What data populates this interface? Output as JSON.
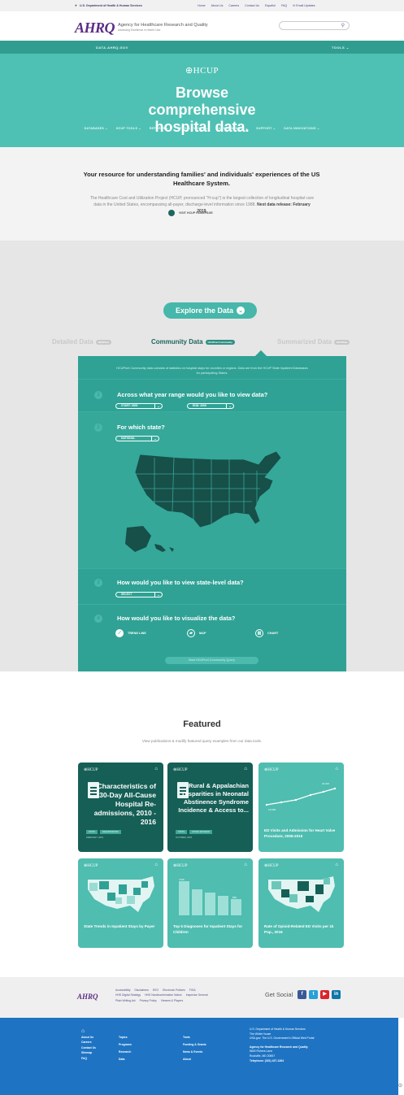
{
  "gov": {
    "dept": "U.S. Department of Health & Human Services",
    "links": [
      "Home",
      "About Us",
      "Careers",
      "Contact Us",
      "Español",
      "FAQ",
      "Email Updates"
    ]
  },
  "brand": {
    "logo": "AHRQ",
    "agency": "Agency for Healthcare Research and Quality",
    "tagline": "Advancing Excellence in Health Care",
    "search_placeholder": ""
  },
  "datanav": {
    "site": "DATA.AHRQ.GOV",
    "tools": "TOOLS ⌄"
  },
  "hero": {
    "hcup": "⊕HCUP",
    "title": "Browse comprehensive hospital data.",
    "menu": [
      "DATABASES ⌄",
      "HCUP TOOLS ⌄",
      "REPORTS ⌄",
      "NEWS & EVENTS ⌄",
      "PURCHASE DATA ⌄",
      "SUPPORT ⌄",
      "DATA INNOVATIONS ⌄"
    ]
  },
  "intro": {
    "heading": "Your resource for understanding families' and individuals' experiences of the US Healthcare System.",
    "body": "The Healthcare Cost and Utilization Project (HCUP, pronounced \"H-cup\") is the largest collection of longitudinal hospital care data in the United States, encompassing all-payer, discharge-level information since 1988.",
    "release": "Next data release: February 2019.",
    "visit": "VISIT HCUP HOMEPAGE"
  },
  "explore": {
    "button": "Explore the Data",
    "tabs": [
      {
        "label": "Detailed Data",
        "badge": "HCUPnet"
      },
      {
        "label": "Community Data",
        "badge": "HCUPnet Community"
      },
      {
        "label": "Summarized Data",
        "badge": "HCUPnet"
      }
    ],
    "note": "HCUPnet Community data consists of statistics on hospital stays for counties or regions. Data are from the HCUP State Inpatient Databases for participating States.",
    "questions": [
      {
        "num": "1",
        "text": "Across what year range would you like to view data?"
      },
      {
        "num": "2",
        "text": "For which state?"
      },
      {
        "num": "3",
        "text": "How would you like to view state-level data?"
      },
      {
        "num": "4",
        "text": "How would you like to visualize the data?"
      }
    ],
    "start": "START: 2005",
    "end": "END: 2009",
    "state": "NATIONAL",
    "level": "SELECT",
    "viz": [
      "TREND LINE",
      "MAP",
      "CHART"
    ],
    "go": "Start HCUPnet Community Query"
  },
  "featured": {
    "title": "Featured",
    "subtitle": "View publications & modify featured query examples from our data tools.",
    "cards": [
      {
        "title": "Characteristics of 30-Day All-Cause Hospital Re-admissions, 2010 - 2016",
        "tags": [
          "STATS",
          "READMISSIONS"
        ],
        "date": "FEBRUARY, 2019"
      },
      {
        "title": "Rural & Appalachian Disparities in Neonatal Abstinence Syndrome Incidence & Access to...",
        "tags": [
          "STATS",
          "OPIOID EPIDEMIC"
        ],
        "date": "OCTOBER, 2018"
      },
      {
        "title": "ED Visits and Admission for Heart Valve Procedure, 2006-2016",
        "val1": "22,010",
        "val2": "13,500"
      },
      {
        "title": "State Trends in Inpatient Stays by Payer"
      },
      {
        "title": "Top 5 Diagnoses for Inpatient Stays for Children",
        "val1": "7156",
        "val2": "865"
      },
      {
        "title": "Rate of Opioid-Related ED Visits per 1k Pop., 2016"
      }
    ]
  },
  "footer": {
    "logo": "AHRQ",
    "links": [
      "Accessibility",
      "Disclaimers",
      "EEO",
      "Electronic Policies",
      "FOIA",
      "HHS Digital Strategy",
      "HHS Nondiscrimination Notice",
      "Inspector General",
      "Plain Writing Act",
      "Privacy Policy",
      "Viewers & Players"
    ],
    "social": "Get Social",
    "col1": [
      "About Us",
      "Careers",
      "Contact Us",
      "Sitemap",
      "FAQ"
    ],
    "col2": [
      "Topics",
      "Programs",
      "Research",
      "Data"
    ],
    "col3": [
      "Tools",
      "Funding & Grants",
      "News & Events",
      "About"
    ],
    "col4": [
      "U.S. Department of Health & Human Services",
      "The White House",
      "USA.gov: The U.S. Government's Official Web Portal",
      "",
      "Agency for Healthcare Research and Quality",
      "5600 Fishers Lane",
      "Rockville, MD 20857",
      "Telephone: (301) 427-1364"
    ]
  },
  "colors": {
    "teal": "#4fc1b4",
    "darkteal": "#155f56",
    "blue": "#1e74c3",
    "purple": "#5b2c86"
  }
}
